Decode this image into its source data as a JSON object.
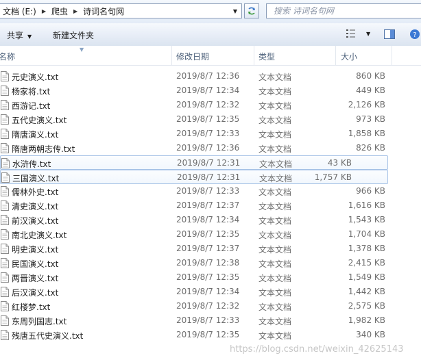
{
  "address": {
    "crumbs": [
      "文档 (E:)",
      "爬虫",
      "诗词名句网"
    ]
  },
  "search": {
    "placeholder": "搜索 诗词名句网"
  },
  "toolbar": {
    "share_label": "共享",
    "new_folder_label": "新建文件夹"
  },
  "columns": {
    "name": "名称",
    "modified": "修改日期",
    "type": "类型",
    "size": "大小"
  },
  "files": [
    {
      "name": "元史演义.txt",
      "modified": "2019/8/7 12:36",
      "type": "文本文档",
      "size": "860 KB"
    },
    {
      "name": "杨家将.txt",
      "modified": "2019/8/7 12:34",
      "type": "文本文档",
      "size": "449 KB"
    },
    {
      "name": "西游记.txt",
      "modified": "2019/8/7 12:32",
      "type": "文本文档",
      "size": "2,126 KB"
    },
    {
      "name": "五代史演义.txt",
      "modified": "2019/8/7 12:35",
      "type": "文本文档",
      "size": "973 KB"
    },
    {
      "name": "隋唐演义.txt",
      "modified": "2019/8/7 12:33",
      "type": "文本文档",
      "size": "1,858 KB"
    },
    {
      "name": "隋唐两朝志传.txt",
      "modified": "2019/8/7 12:36",
      "type": "文本文档",
      "size": "826 KB"
    },
    {
      "name": "水浒传.txt",
      "modified": "2019/8/7 12:31",
      "type": "文本文档",
      "size": "43 KB",
      "highlighted": true
    },
    {
      "name": "三国演义.txt",
      "modified": "2019/8/7 12:31",
      "type": "文本文档",
      "size": "1,757 KB",
      "highlighted": true
    },
    {
      "name": "儒林外史.txt",
      "modified": "2019/8/7 12:33",
      "type": "文本文档",
      "size": "966 KB"
    },
    {
      "name": "清史演义.txt",
      "modified": "2019/8/7 12:37",
      "type": "文本文档",
      "size": "1,616 KB"
    },
    {
      "name": "前汉演义.txt",
      "modified": "2019/8/7 12:34",
      "type": "文本文档",
      "size": "1,543 KB"
    },
    {
      "name": "南北史演义.txt",
      "modified": "2019/8/7 12:35",
      "type": "文本文档",
      "size": "1,704 KB"
    },
    {
      "name": "明史演义.txt",
      "modified": "2019/8/7 12:37",
      "type": "文本文档",
      "size": "1,378 KB"
    },
    {
      "name": "民国演义.txt",
      "modified": "2019/8/7 12:38",
      "type": "文本文档",
      "size": "2,415 KB"
    },
    {
      "name": "两晋演义.txt",
      "modified": "2019/8/7 12:35",
      "type": "文本文档",
      "size": "1,549 KB"
    },
    {
      "name": "后汉演义.txt",
      "modified": "2019/8/7 12:34",
      "type": "文本文档",
      "size": "1,442 KB"
    },
    {
      "name": "红楼梦.txt",
      "modified": "2019/8/7 12:32",
      "type": "文本文档",
      "size": "2,575 KB"
    },
    {
      "name": "东周列国志.txt",
      "modified": "2019/8/7 12:33",
      "type": "文本文档",
      "size": "1,982 KB"
    },
    {
      "name": "残唐五代史演义.txt",
      "modified": "2019/8/7 12:35",
      "type": "文本文档",
      "size": "340 KB"
    }
  ],
  "watermark": "https://blog.csdn.net/weixin_42625143",
  "colors": {
    "highlight_border": "#a9c4e7",
    "header_text": "#4c607a",
    "meta_text": "#6d6d6d"
  },
  "icons": {
    "nav_arrow": "chevron-right-icon",
    "refresh": "refresh-icon",
    "view": "view-options-icon",
    "preview": "preview-pane-icon",
    "help": "help-icon",
    "file": "text-file-icon"
  }
}
